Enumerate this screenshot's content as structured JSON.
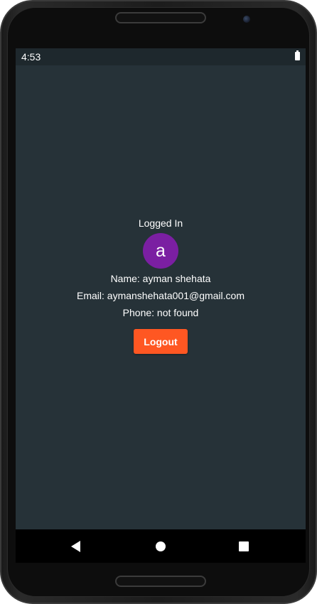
{
  "status_bar": {
    "time": "4:53",
    "battery_icon": "battery-full-icon"
  },
  "profile": {
    "heading": "Logged In",
    "avatar_letter": "a",
    "avatar_color": "#7b1fa2",
    "name_line": "Name: ayman shehata",
    "email_line": "Email: aymanshehata001@gmail.com",
    "phone_line": "Phone: not found"
  },
  "actions": {
    "logout_label": "Logout",
    "logout_color": "#ff5722"
  },
  "navigation": {
    "back_icon": "back-triangle-icon",
    "home_icon": "home-circle-icon",
    "recents_icon": "recents-square-icon"
  },
  "theme": {
    "background": "#263238",
    "text_color": "#ffffff"
  }
}
